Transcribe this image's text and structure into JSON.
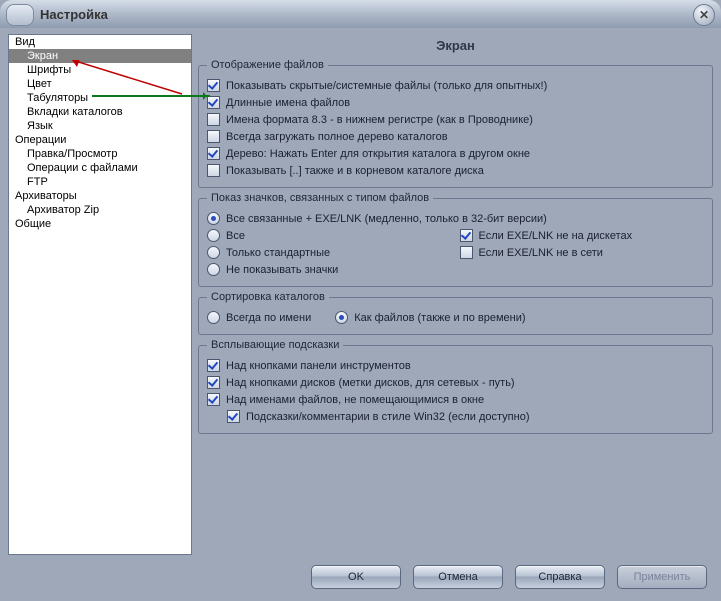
{
  "window": {
    "title": "Настройка"
  },
  "sidebar": {
    "items": [
      {
        "label": "Вид",
        "level": 0,
        "selected": false
      },
      {
        "label": "Экран",
        "level": 1,
        "selected": true
      },
      {
        "label": "Шрифты",
        "level": 1,
        "selected": false
      },
      {
        "label": "Цвет",
        "level": 1,
        "selected": false
      },
      {
        "label": "Табуляторы",
        "level": 1,
        "selected": false
      },
      {
        "label": "Вкладки каталогов",
        "level": 1,
        "selected": false
      },
      {
        "label": "Язык",
        "level": 1,
        "selected": false
      },
      {
        "label": "Операции",
        "level": 0,
        "selected": false
      },
      {
        "label": "Правка/Просмотр",
        "level": 1,
        "selected": false
      },
      {
        "label": "Операции с файлами",
        "level": 1,
        "selected": false
      },
      {
        "label": "FTP",
        "level": 1,
        "selected": false
      },
      {
        "label": "Архиваторы",
        "level": 0,
        "selected": false
      },
      {
        "label": "Архиватор Zip",
        "level": 1,
        "selected": false
      },
      {
        "label": "Общие",
        "level": 0,
        "selected": false
      }
    ]
  },
  "pane": {
    "title": "Экран"
  },
  "group_display": {
    "legend": "Отображение файлов",
    "opts": [
      {
        "label": "Показывать скрытые/системные файлы (только для опытных!)",
        "checked": true
      },
      {
        "label": "Длинные имена файлов",
        "checked": true
      },
      {
        "label": "Имена формата 8.3 - в нижнем регистре (как в Проводнике)",
        "checked": false
      },
      {
        "label": "Всегда загружать полное дерево каталогов",
        "checked": false
      },
      {
        "label": "Дерево: Нажать Enter для открытия каталога в другом окне",
        "checked": true
      },
      {
        "label": "Показывать [..] также и в корневом каталоге диска",
        "checked": false
      }
    ]
  },
  "group_icons": {
    "legend": "Показ значков, связанных с типом файлов",
    "left": [
      {
        "label": "Все связанные + EXE/LNK (медленно, только в 32-бит версии)",
        "selected": true
      },
      {
        "label": "Все",
        "selected": false
      },
      {
        "label": "Только стандартные",
        "selected": false
      },
      {
        "label": "Не показывать значки",
        "selected": false
      }
    ],
    "right": [
      {
        "label": "Если EXE/LNK не на дискетах",
        "checked": true
      },
      {
        "label": "Если EXE/LNK не в сети",
        "checked": false
      }
    ]
  },
  "group_sort": {
    "legend": "Сортировка каталогов",
    "opts": [
      {
        "label": "Всегда по имени",
        "selected": false
      },
      {
        "label": "Как файлов (также и по времени)",
        "selected": true
      }
    ]
  },
  "group_tips": {
    "legend": "Всплывающие подсказки",
    "opts": [
      {
        "label": "Над кнопками панели инструментов",
        "checked": true
      },
      {
        "label": "Над кнопками дисков (метки дисков, для сетевых - путь)",
        "checked": true
      },
      {
        "label": "Над именами файлов, не помещающимися в окне",
        "checked": true
      }
    ],
    "sub": {
      "label": "Подсказки/комментарии в стиле Win32 (если доступно)",
      "checked": true
    }
  },
  "buttons": {
    "ok": "OK",
    "cancel": "Отмена",
    "help": "Справка",
    "apply": "Применить"
  }
}
